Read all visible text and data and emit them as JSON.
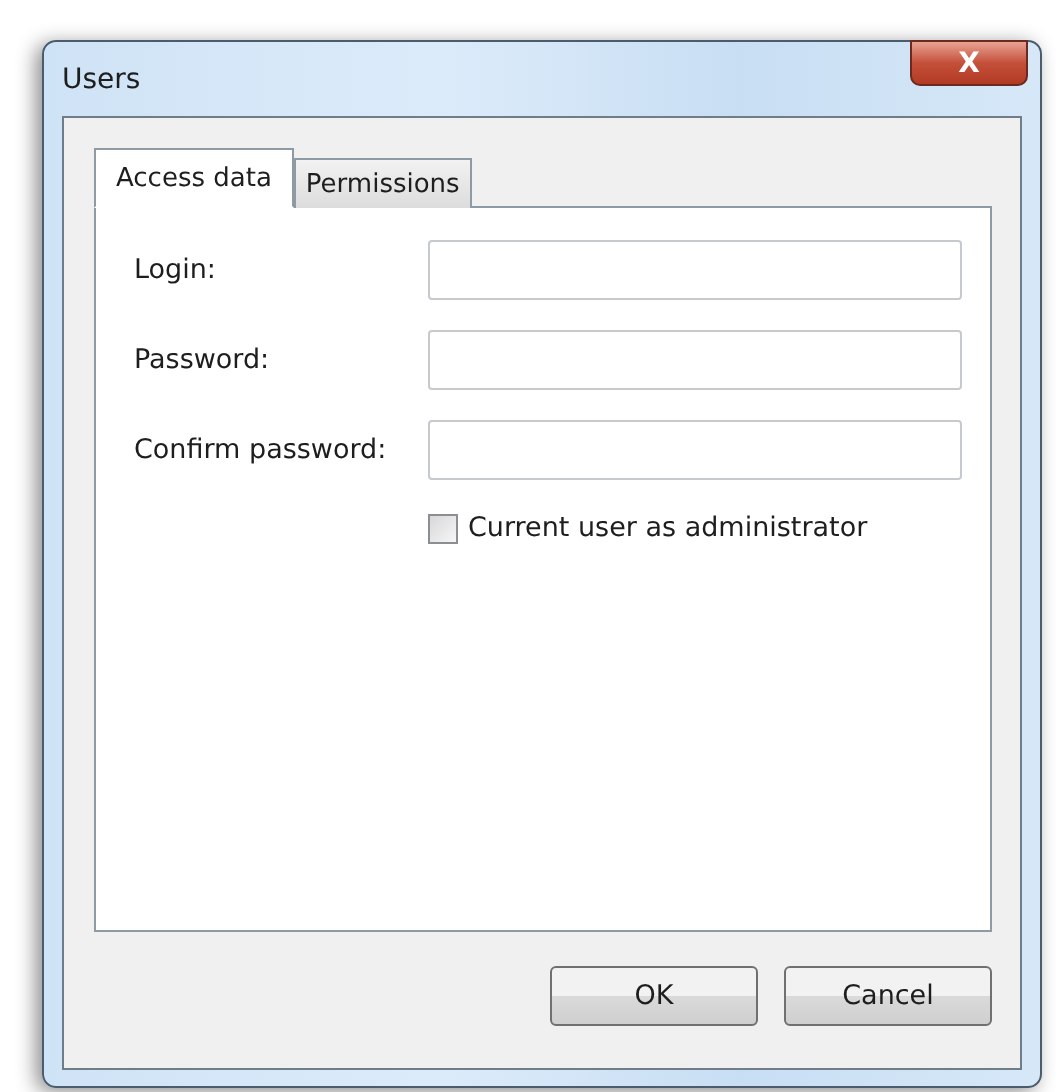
{
  "window": {
    "title": "Users",
    "close": "X"
  },
  "tabs": [
    {
      "label": "Access data",
      "selected": true
    },
    {
      "label": "Permissions",
      "selected": false
    }
  ],
  "fields": [
    {
      "label": "Login:"
    },
    {
      "label": "Password:"
    },
    {
      "label": "Confirm password:"
    }
  ],
  "checkbox": {
    "label": "Current user as administrator",
    "checked": false
  },
  "buttons": [
    "OK",
    "Cancel"
  ]
}
